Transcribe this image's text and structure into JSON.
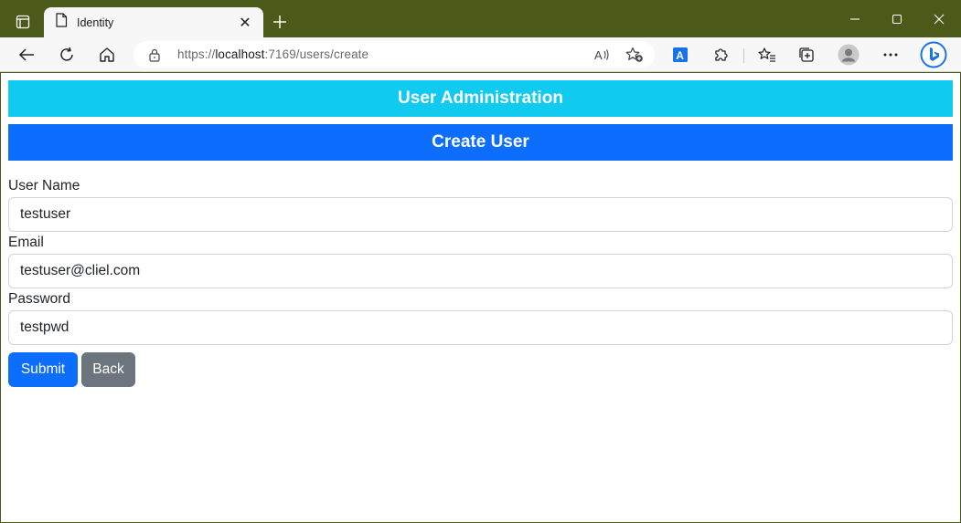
{
  "browser": {
    "tab_title": "Identity",
    "url_scheme": "https://",
    "url_host": "localhost",
    "url_rest": ":7169/users/create",
    "accent_color": "#4b5a18"
  },
  "page": {
    "admin_banner": "User Administration",
    "create_banner": "Create User",
    "fields": {
      "username_label": "User Name",
      "username_value": "testuser",
      "email_label": "Email",
      "email_value": "testuser@cliel.com",
      "password_label": "Password",
      "password_value": "testpwd"
    },
    "buttons": {
      "submit": "Submit",
      "back": "Back"
    },
    "colors": {
      "info": "#11caf0",
      "primary": "#0d6efd",
      "secondary": "#6c757d"
    }
  }
}
